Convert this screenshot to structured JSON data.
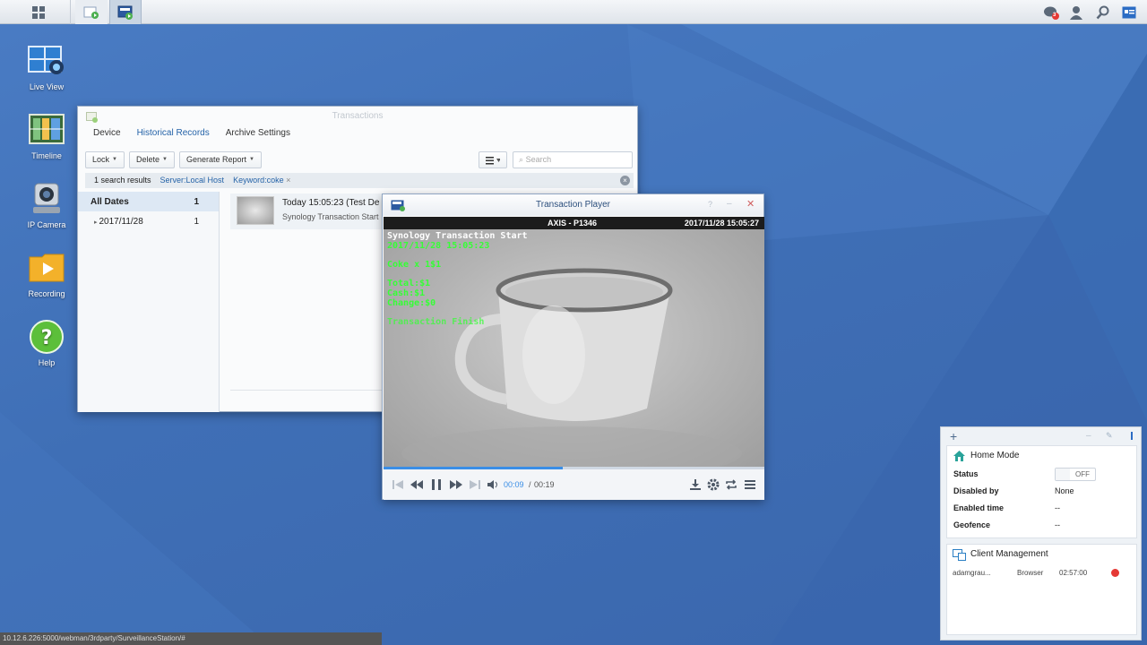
{
  "taskbar": {
    "apps": [
      "main-menu",
      "surveillance-center",
      "transaction-player"
    ],
    "notification_count": "3"
  },
  "desktop_icons": [
    {
      "label": "Live View",
      "icon": "live-view-icon"
    },
    {
      "label": "Timeline",
      "icon": "timeline-icon"
    },
    {
      "label": "IP Camera",
      "icon": "ip-camera-icon"
    },
    {
      "label": "Recording",
      "icon": "recording-icon"
    },
    {
      "label": "Help",
      "icon": "help-icon"
    }
  ],
  "transactions": {
    "title": "Transactions",
    "tabs": [
      "Device",
      "Historical Records",
      "Archive Settings"
    ],
    "active_tab": "Historical Records",
    "toolbar": {
      "lock": "Lock",
      "delete": "Delete",
      "report": "Generate Report"
    },
    "search_placeholder": "Search",
    "filter": {
      "count_text": "1 search results",
      "server": "Server:Local Host",
      "keyword": "Keyword:coke",
      "remove": "×"
    },
    "sidebar": [
      {
        "label": "All Dates",
        "count": "1"
      },
      {
        "label": "2017/11/28",
        "count": "1"
      }
    ],
    "result": {
      "time": "Today 15:05:23 (Test De",
      "subtitle": "Synology Transaction Start"
    }
  },
  "player": {
    "title": "Transaction Player",
    "camera": "AXIS - P1346",
    "timestamp": "2017/11/28 15:05:27",
    "overlay": {
      "line1": "Synology Transaction Start",
      "line2": "2017/11/28 15:05:23",
      "line3": "Coke x 1$1",
      "line4": "Total:$1",
      "line5": "Cash:$1",
      "line6": "Change:$0",
      "line7": "Transaction Finish"
    },
    "time_current": "00:09",
    "time_separator": "/",
    "time_total": "00:19",
    "progress": 0.47
  },
  "widget": {
    "home_mode": {
      "title": "Home Mode",
      "rows": [
        {
          "k": "Status",
          "v": "OFF"
        },
        {
          "k": "Disabled by",
          "v": "None"
        },
        {
          "k": "Enabled time",
          "v": "--"
        },
        {
          "k": "Geofence",
          "v": "--"
        }
      ]
    },
    "client": {
      "title": "Client Management",
      "user": "adamgrau...",
      "type": "Browser",
      "time": "02:57:00"
    }
  },
  "status_url": "10.12.6.226:5000/webman/3rdparty/SurveillanceStation/#"
}
